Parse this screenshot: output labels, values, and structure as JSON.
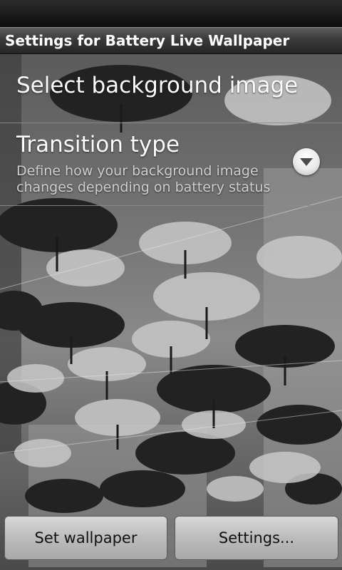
{
  "title_bar": {
    "title": "Settings for Battery Live Wallpaper"
  },
  "preferences": [
    {
      "title": "Select background image"
    },
    {
      "title": "Transition type",
      "summary": "Define how your background image changes depending on battery status",
      "icon": "chevron-down-icon"
    }
  ],
  "buttons": {
    "set_wallpaper": "Set wallpaper",
    "settings": "Settings..."
  }
}
